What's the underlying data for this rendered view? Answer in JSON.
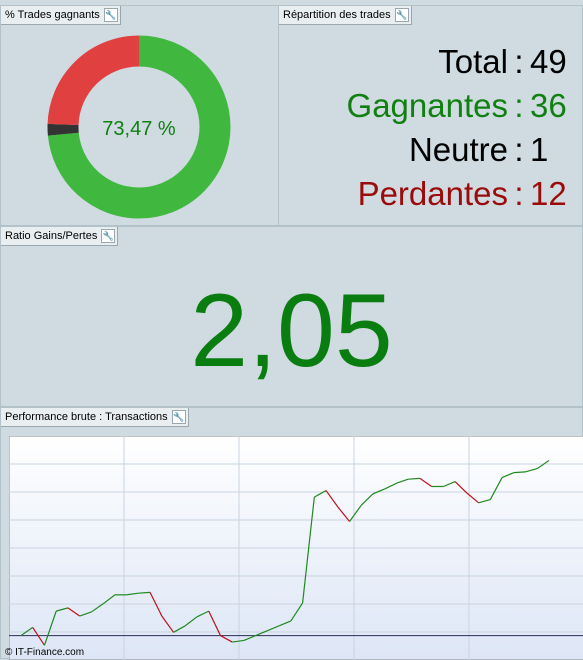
{
  "panels": {
    "pct": {
      "title": "% Trades gagnants",
      "center_label": "73,47 %"
    },
    "repart": {
      "title": "Répartition des trades",
      "rows": [
        {
          "label": "Total",
          "sep": ":",
          "value": "49",
          "color": "#000000"
        },
        {
          "label": "Gagnantes",
          "sep": ":",
          "value": "36",
          "color": "#108010"
        },
        {
          "label": "Neutre",
          "sep": ":",
          "value": "1",
          "color": "#000000"
        },
        {
          "label": "Perdantes",
          "sep": ":",
          "value": "12",
          "color": "#9b0b0b"
        }
      ]
    },
    "ratio": {
      "title": "Ratio Gains/Pertes",
      "value": "2,05"
    },
    "perf": {
      "title": "Performance brute : Transactions"
    }
  },
  "donut": {
    "slices": [
      {
        "name": "Gagnantes",
        "value": 36,
        "color": "#40b840"
      },
      {
        "name": "Neutre",
        "value": 1,
        "color": "#333333"
      },
      {
        "name": "Perdantes",
        "value": 12,
        "color": "#e04040"
      }
    ]
  },
  "chart_data": {
    "type": "line",
    "title": "",
    "series": [
      {
        "values": [
          0,
          10,
          -12,
          30,
          34,
          24,
          29,
          39,
          50,
          50,
          52,
          53,
          24,
          4,
          12,
          23,
          30,
          0,
          -8,
          -6,
          0,
          6,
          12,
          18,
          40,
          170,
          178,
          158,
          140,
          160,
          174,
          180,
          187,
          192,
          193,
          183,
          183,
          189,
          175,
          163,
          167,
          194,
          200,
          201,
          205,
          215
        ]
      }
    ],
    "up_color": "#1e8a1e",
    "down_color": "#c0101c",
    "baseline": 0,
    "ylim": [
      -30,
      245
    ],
    "grid": true
  },
  "footer": "© IT-Finance.com"
}
